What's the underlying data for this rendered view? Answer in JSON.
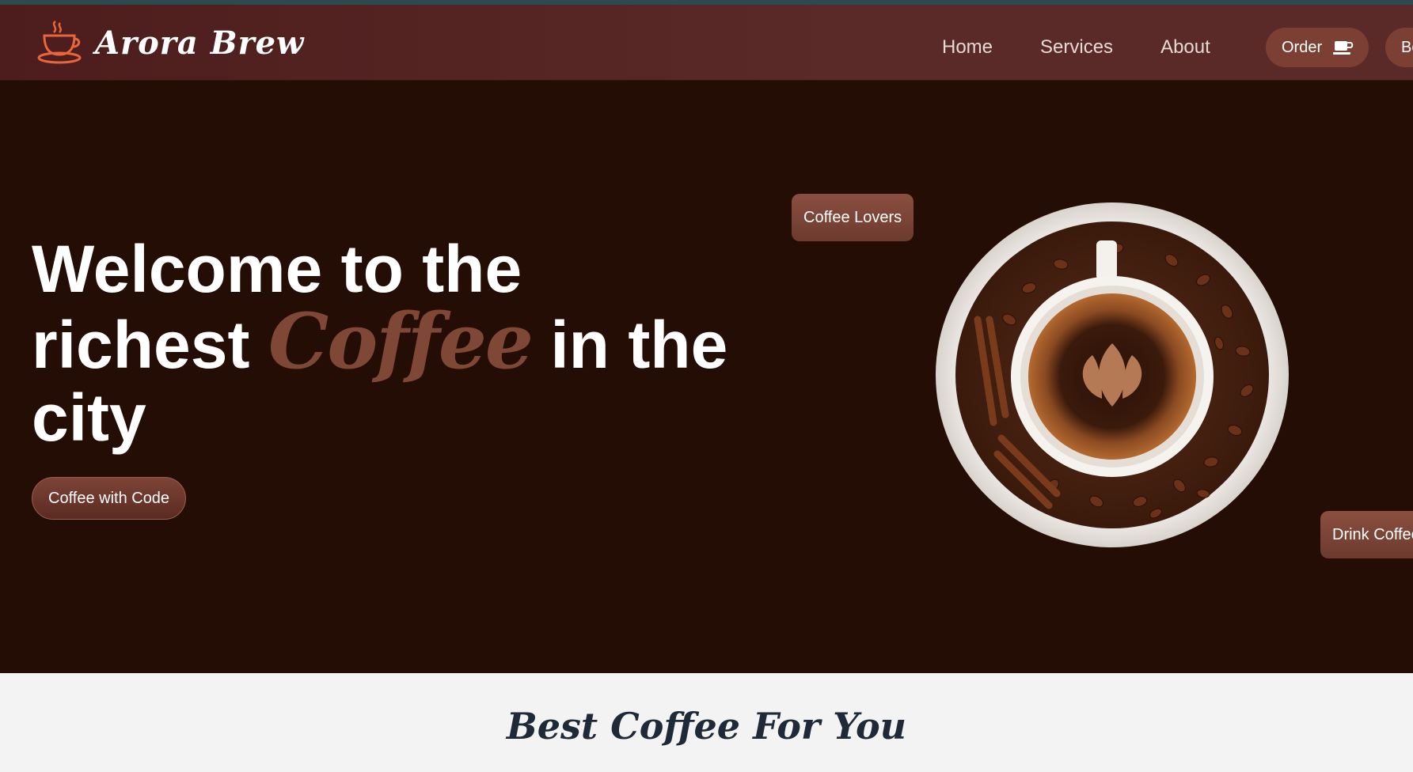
{
  "brand": {
    "name": "Arora Brew",
    "logo_icon": "coffee-cup-icon"
  },
  "nav": {
    "links": [
      "Home",
      "Services",
      "About"
    ],
    "order_label": "Order",
    "order_icon": "coffee-cup-icon",
    "book_label": "Bo"
  },
  "hero": {
    "title_part1": "Welcome to the richest",
    "title_highlight": "Coffee",
    "title_part2": "in the city",
    "cta_label": "Coffee with Code",
    "badge_top": "Coffee Lovers",
    "badge_bottom": "Drink Coffee",
    "image": "coffee-cup-with-beans"
  },
  "section": {
    "title": "Best Coffee For You"
  },
  "colors": {
    "navbar": "#5a2a28",
    "hero_bg": "#240d04",
    "accent": "#7f4735",
    "logo": "#e8663a",
    "section_bg": "#f3f3f3",
    "section_title": "#1f2a38"
  }
}
